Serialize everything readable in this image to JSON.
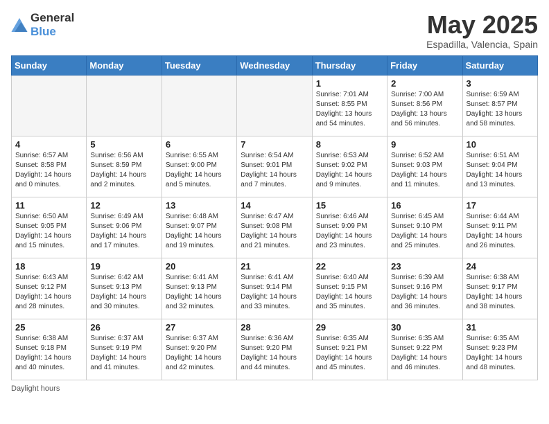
{
  "header": {
    "logo_general": "General",
    "logo_blue": "Blue",
    "title": "May 2025",
    "location": "Espadilla, Valencia, Spain"
  },
  "weekdays": [
    "Sunday",
    "Monday",
    "Tuesday",
    "Wednesday",
    "Thursday",
    "Friday",
    "Saturday"
  ],
  "footer": {
    "daylight_label": "Daylight hours"
  },
  "weeks": [
    [
      {
        "day": "",
        "empty": true
      },
      {
        "day": "",
        "empty": true
      },
      {
        "day": "",
        "empty": true
      },
      {
        "day": "",
        "empty": true
      },
      {
        "day": "1",
        "sunrise": "Sunrise: 7:01 AM",
        "sunset": "Sunset: 8:55 PM",
        "daylight": "Daylight: 13 hours and 54 minutes."
      },
      {
        "day": "2",
        "sunrise": "Sunrise: 7:00 AM",
        "sunset": "Sunset: 8:56 PM",
        "daylight": "Daylight: 13 hours and 56 minutes."
      },
      {
        "day": "3",
        "sunrise": "Sunrise: 6:59 AM",
        "sunset": "Sunset: 8:57 PM",
        "daylight": "Daylight: 13 hours and 58 minutes."
      }
    ],
    [
      {
        "day": "4",
        "sunrise": "Sunrise: 6:57 AM",
        "sunset": "Sunset: 8:58 PM",
        "daylight": "Daylight: 14 hours and 0 minutes."
      },
      {
        "day": "5",
        "sunrise": "Sunrise: 6:56 AM",
        "sunset": "Sunset: 8:59 PM",
        "daylight": "Daylight: 14 hours and 2 minutes."
      },
      {
        "day": "6",
        "sunrise": "Sunrise: 6:55 AM",
        "sunset": "Sunset: 9:00 PM",
        "daylight": "Daylight: 14 hours and 5 minutes."
      },
      {
        "day": "7",
        "sunrise": "Sunrise: 6:54 AM",
        "sunset": "Sunset: 9:01 PM",
        "daylight": "Daylight: 14 hours and 7 minutes."
      },
      {
        "day": "8",
        "sunrise": "Sunrise: 6:53 AM",
        "sunset": "Sunset: 9:02 PM",
        "daylight": "Daylight: 14 hours and 9 minutes."
      },
      {
        "day": "9",
        "sunrise": "Sunrise: 6:52 AM",
        "sunset": "Sunset: 9:03 PM",
        "daylight": "Daylight: 14 hours and 11 minutes."
      },
      {
        "day": "10",
        "sunrise": "Sunrise: 6:51 AM",
        "sunset": "Sunset: 9:04 PM",
        "daylight": "Daylight: 14 hours and 13 minutes."
      }
    ],
    [
      {
        "day": "11",
        "sunrise": "Sunrise: 6:50 AM",
        "sunset": "Sunset: 9:05 PM",
        "daylight": "Daylight: 14 hours and 15 minutes."
      },
      {
        "day": "12",
        "sunrise": "Sunrise: 6:49 AM",
        "sunset": "Sunset: 9:06 PM",
        "daylight": "Daylight: 14 hours and 17 minutes."
      },
      {
        "day": "13",
        "sunrise": "Sunrise: 6:48 AM",
        "sunset": "Sunset: 9:07 PM",
        "daylight": "Daylight: 14 hours and 19 minutes."
      },
      {
        "day": "14",
        "sunrise": "Sunrise: 6:47 AM",
        "sunset": "Sunset: 9:08 PM",
        "daylight": "Daylight: 14 hours and 21 minutes."
      },
      {
        "day": "15",
        "sunrise": "Sunrise: 6:46 AM",
        "sunset": "Sunset: 9:09 PM",
        "daylight": "Daylight: 14 hours and 23 minutes."
      },
      {
        "day": "16",
        "sunrise": "Sunrise: 6:45 AM",
        "sunset": "Sunset: 9:10 PM",
        "daylight": "Daylight: 14 hours and 25 minutes."
      },
      {
        "day": "17",
        "sunrise": "Sunrise: 6:44 AM",
        "sunset": "Sunset: 9:11 PM",
        "daylight": "Daylight: 14 hours and 26 minutes."
      }
    ],
    [
      {
        "day": "18",
        "sunrise": "Sunrise: 6:43 AM",
        "sunset": "Sunset: 9:12 PM",
        "daylight": "Daylight: 14 hours and 28 minutes."
      },
      {
        "day": "19",
        "sunrise": "Sunrise: 6:42 AM",
        "sunset": "Sunset: 9:13 PM",
        "daylight": "Daylight: 14 hours and 30 minutes."
      },
      {
        "day": "20",
        "sunrise": "Sunrise: 6:41 AM",
        "sunset": "Sunset: 9:13 PM",
        "daylight": "Daylight: 14 hours and 32 minutes."
      },
      {
        "day": "21",
        "sunrise": "Sunrise: 6:41 AM",
        "sunset": "Sunset: 9:14 PM",
        "daylight": "Daylight: 14 hours and 33 minutes."
      },
      {
        "day": "22",
        "sunrise": "Sunrise: 6:40 AM",
        "sunset": "Sunset: 9:15 PM",
        "daylight": "Daylight: 14 hours and 35 minutes."
      },
      {
        "day": "23",
        "sunrise": "Sunrise: 6:39 AM",
        "sunset": "Sunset: 9:16 PM",
        "daylight": "Daylight: 14 hours and 36 minutes."
      },
      {
        "day": "24",
        "sunrise": "Sunrise: 6:38 AM",
        "sunset": "Sunset: 9:17 PM",
        "daylight": "Daylight: 14 hours and 38 minutes."
      }
    ],
    [
      {
        "day": "25",
        "sunrise": "Sunrise: 6:38 AM",
        "sunset": "Sunset: 9:18 PM",
        "daylight": "Daylight: 14 hours and 40 minutes."
      },
      {
        "day": "26",
        "sunrise": "Sunrise: 6:37 AM",
        "sunset": "Sunset: 9:19 PM",
        "daylight": "Daylight: 14 hours and 41 minutes."
      },
      {
        "day": "27",
        "sunrise": "Sunrise: 6:37 AM",
        "sunset": "Sunset: 9:20 PM",
        "daylight": "Daylight: 14 hours and 42 minutes."
      },
      {
        "day": "28",
        "sunrise": "Sunrise: 6:36 AM",
        "sunset": "Sunset: 9:20 PM",
        "daylight": "Daylight: 14 hours and 44 minutes."
      },
      {
        "day": "29",
        "sunrise": "Sunrise: 6:35 AM",
        "sunset": "Sunset: 9:21 PM",
        "daylight": "Daylight: 14 hours and 45 minutes."
      },
      {
        "day": "30",
        "sunrise": "Sunrise: 6:35 AM",
        "sunset": "Sunset: 9:22 PM",
        "daylight": "Daylight: 14 hours and 46 minutes."
      },
      {
        "day": "31",
        "sunrise": "Sunrise: 6:35 AM",
        "sunset": "Sunset: 9:23 PM",
        "daylight": "Daylight: 14 hours and 48 minutes."
      }
    ]
  ]
}
